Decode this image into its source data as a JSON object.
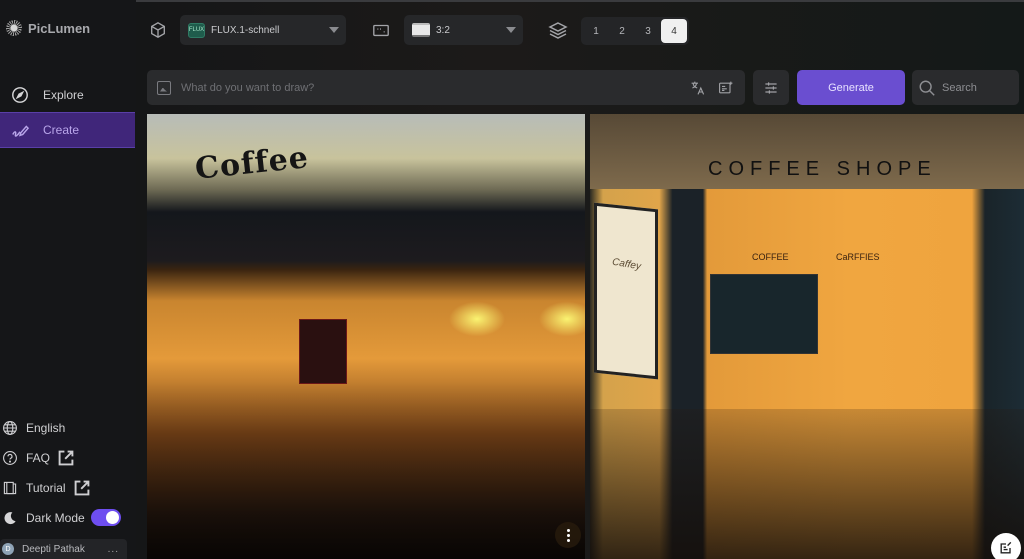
{
  "app": {
    "name": "PicLumen"
  },
  "sidebar": {
    "nav": [
      {
        "label": "Explore",
        "icon": "compass-icon",
        "active": false
      },
      {
        "label": "Create",
        "icon": "create-icon",
        "active": true
      }
    ],
    "bottom": {
      "language": "English",
      "faq": "FAQ",
      "tutorial": "Tutorial",
      "dark_mode": "Dark Mode",
      "dark_mode_on": true
    },
    "user": {
      "initial": "D",
      "name": "Deepti Pathak",
      "more": "..."
    }
  },
  "toolbar": {
    "model": {
      "badge": "FLUX",
      "value": "FLUX.1-schnell"
    },
    "aspect_ratio": {
      "value": "3:2"
    },
    "image_count": {
      "options": [
        "1",
        "2",
        "3",
        "4"
      ],
      "selected": "4"
    }
  },
  "prompt": {
    "placeholder": "What do you want to draw?",
    "value": "",
    "generate_label": "Generate",
    "search_label": "Search"
  },
  "images": [
    {
      "description": "Rainy window of a coffee shop at night",
      "sign_text": "Coffee"
    },
    {
      "description": "Coffee shop storefront with lamp",
      "sign_text": "COFFEE SHOPE",
      "inner_signs": [
        "COFFEE",
        "CaRFFIES"
      ],
      "poster_title": "Caffey"
    }
  ],
  "colors": {
    "accent": "#6a4ed0",
    "active_nav_bg": "#40267a",
    "toggle": "#6e4ef0"
  }
}
